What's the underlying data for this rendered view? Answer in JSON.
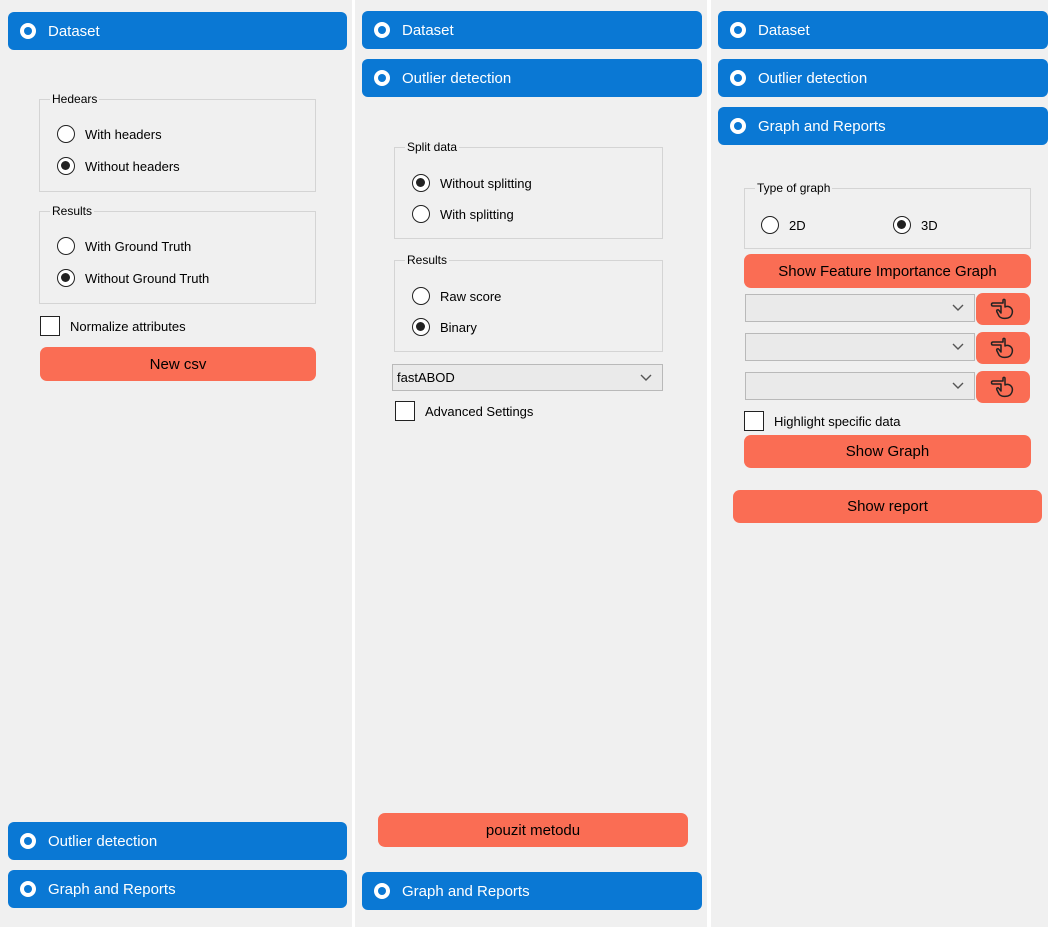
{
  "panel1": {
    "header_dataset": "Dataset",
    "headers_group": {
      "title": "Hedears",
      "opt_with": "With headers",
      "opt_without": "Without headers"
    },
    "results_group": {
      "title": "Results",
      "opt_with": "With Ground Truth",
      "opt_without": "Without Ground Truth"
    },
    "normalize_label": "Normalize attributes",
    "new_csv_button": "New csv",
    "header_outlier": "Outlier detection",
    "header_graph": "Graph and Reports"
  },
  "panel2": {
    "header_dataset": "Dataset",
    "header_outlier": "Outlier detection",
    "split_group": {
      "title": "Split data",
      "opt_without": "Without splitting",
      "opt_with": "With splitting"
    },
    "results_group": {
      "title": "Results",
      "opt_raw": "Raw score",
      "opt_binary": "Binary"
    },
    "method_select": "fastABOD",
    "advanced_label": "Advanced Settings",
    "apply_button": "pouzit metodu",
    "header_graph": "Graph and Reports"
  },
  "panel3": {
    "header_dataset": "Dataset",
    "header_outlier": "Outlier detection",
    "header_graph": "Graph and Reports",
    "graph_type_group": {
      "title": "Type of graph",
      "opt_2d": "2D",
      "opt_3d": "3D"
    },
    "feature_importance_button": "Show Feature Importance Graph",
    "highlight_label": "Highlight specific data",
    "show_graph_button": "Show Graph",
    "show_report_button": "Show report"
  },
  "colors": {
    "header_blue": "#0a78d4",
    "button_orange": "#fa6d54",
    "panel_bg": "#f0f0f0"
  },
  "icons": {
    "section_header": "circle-arrow-icon",
    "picker": "hand-pointer-icon",
    "dropdown": "chevron-down-icon"
  }
}
